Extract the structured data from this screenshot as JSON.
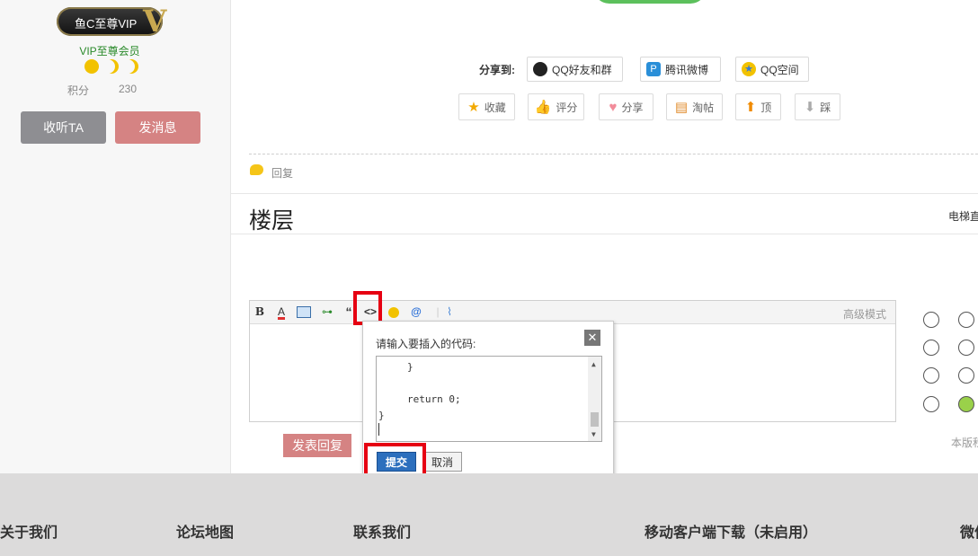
{
  "sidebar": {
    "vip_badge": "鱼C至尊VIP",
    "vip_letter": "V",
    "vip_level": "VIP至尊会员",
    "points_label": "积分",
    "points_value": "230",
    "follow_label": "收听TA",
    "message_label": "发消息"
  },
  "share": {
    "label": "分享到:",
    "items": [
      "QQ好友和群",
      "腾讯微博",
      "QQ空间"
    ]
  },
  "actions": [
    "收藏",
    "评分",
    "分享",
    "淘帖",
    "顶",
    "踩"
  ],
  "reply_link": "回复",
  "floor": {
    "title": "楼层",
    "elevator": "电梯直"
  },
  "editor": {
    "toolbar": {
      "bold": "B",
      "font_color": "A",
      "quote": "“",
      "code": "<>",
      "mention": "@"
    },
    "advanced_mode": "高级模式",
    "submit_reply": "发表回复"
  },
  "code_dialog": {
    "prompt": "请输入要插入的代码:",
    "close": "✕",
    "code_lines": [
      "}",
      "return 0;",
      "}"
    ],
    "submit_label": "提交",
    "cancel_label": "取消"
  },
  "board_rules": "本版积",
  "footer": {
    "links": [
      "关于我们",
      "论坛地图",
      "联系我们",
      "移动客户端下载（未启用）",
      "微信"
    ]
  },
  "colors": {
    "highlight": "#e60012",
    "submit_blue": "#2c6fbd",
    "pink_button": "#d58383"
  }
}
